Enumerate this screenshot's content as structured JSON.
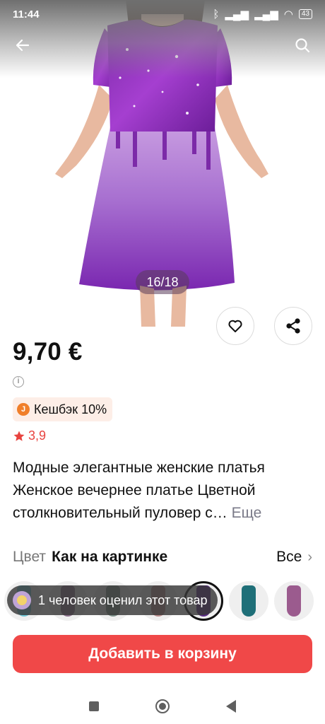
{
  "status_bar": {
    "time": "11:44",
    "battery": "43"
  },
  "gallery": {
    "counter": "16/18"
  },
  "product": {
    "price": "9,70 €",
    "cashback_label": "Кешбэк 10%",
    "cashback_icon_letter": "J",
    "rating": "3,9",
    "title": "Модные элегантные женские платья Женское вечернее платье Цветной столкновительный пуловер с…",
    "more_label": "Еще"
  },
  "color_selector": {
    "label": "Цвет",
    "value": "Как на картинке",
    "all_label": "Все",
    "thumbnail_colors": [
      "#6ec7d6",
      "#8a6d8a",
      "#7b8f88",
      "#b88a8a",
      "#5b2a88",
      "#1f6f78",
      "#9b5b8e"
    ]
  },
  "tooltip": {
    "text": "1 человек оценил этот товар"
  },
  "actions": {
    "add_to_cart": "Добавить в корзину"
  },
  "colors": {
    "accent": "#f04848",
    "rating": "#e8433f",
    "cashback_bg": "#fdeee7"
  }
}
